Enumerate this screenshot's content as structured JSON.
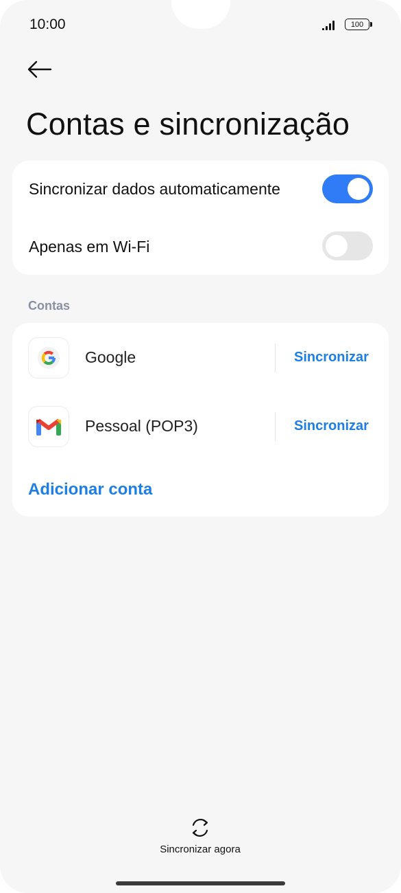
{
  "status_bar": {
    "time": "10:00",
    "battery": "100"
  },
  "header": {
    "title": "Contas e sincronização"
  },
  "sync_settings": {
    "auto_sync": {
      "label": "Sincronizar dados automaticamente",
      "enabled": true
    },
    "wifi_only": {
      "label": "Apenas em Wi-Fi",
      "enabled": false
    }
  },
  "accounts": {
    "section_title": "Contas",
    "items": [
      {
        "name": "Google",
        "icon": "google-icon",
        "action": "Sincronizar"
      },
      {
        "name": "Pessoal (POP3)",
        "icon": "gmail-icon",
        "action": "Sincronizar"
      }
    ],
    "add_label": "Adicionar conta"
  },
  "footer": {
    "sync_now_label": "Sincronizar agora"
  },
  "colors": {
    "accent": "#2f7cf6",
    "link": "#1d7ee6",
    "background": "#f6f6f6",
    "card": "#ffffff"
  }
}
